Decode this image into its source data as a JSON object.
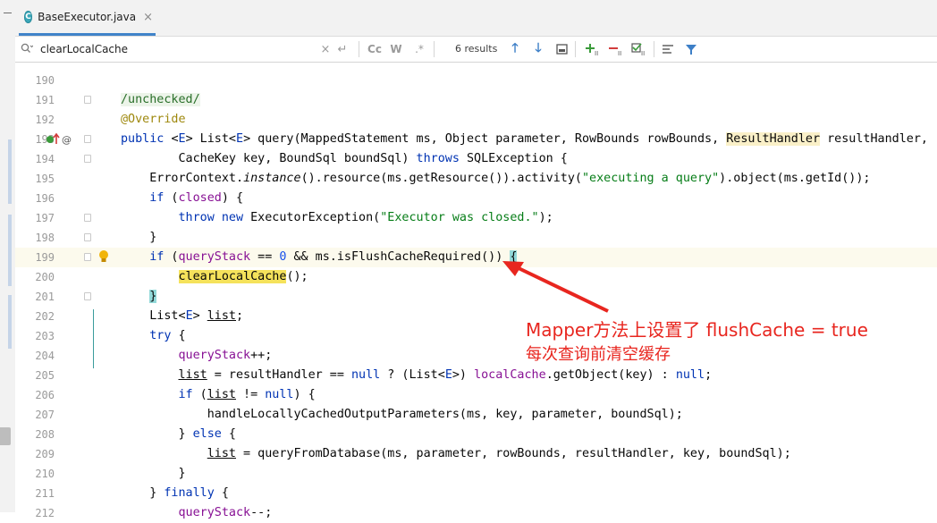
{
  "tab": {
    "filename": "BaseExecutor.java",
    "icon": "java-class-icon",
    "close": "×"
  },
  "search": {
    "value": "clearLocalCache",
    "results": "6 results",
    "buttons": [
      "Cc",
      "W",
      ".*"
    ]
  },
  "lines": [
    {
      "n": "190",
      "segs": []
    },
    {
      "n": "191",
      "segs": [
        [
          "cm",
          "/unchecked/"
        ]
      ]
    },
    {
      "n": "192",
      "segs": [
        [
          "an",
          "@Override"
        ]
      ]
    },
    {
      "n": "193",
      "segs": [
        [
          "kw",
          "public "
        ],
        [
          "",
          "<"
        ],
        [
          "gen",
          "E"
        ],
        [
          "",
          "> List<"
        ],
        [
          "gen",
          "E"
        ],
        [
          "",
          "> query(MappedStatement ms, Object parameter, RowBounds rowBounds, "
        ],
        [
          "rh",
          "ResultHandler"
        ],
        [
          "",
          " resultHandler,"
        ]
      ]
    },
    {
      "n": "194",
      "segs": [
        [
          "",
          "        CacheKey key, BoundSql boundSql) "
        ],
        [
          "kw",
          "throws"
        ],
        [
          "",
          " SQLException {"
        ]
      ]
    },
    {
      "n": "195",
      "segs": [
        [
          "",
          "    ErrorContext."
        ],
        [
          "it",
          "instance"
        ],
        [
          "",
          "().resource(ms.getResource()).activity("
        ],
        [
          "str",
          "\"executing a query\""
        ],
        [
          "",
          ").object(ms.getId());"
        ]
      ]
    },
    {
      "n": "196",
      "segs": [
        [
          "",
          "    "
        ],
        [
          "kw",
          "if"
        ],
        [
          "",
          " ("
        ],
        [
          "fld",
          "closed"
        ],
        [
          "",
          ") {"
        ]
      ]
    },
    {
      "n": "197",
      "segs": [
        [
          "",
          "        "
        ],
        [
          "kw",
          "throw new"
        ],
        [
          "",
          " ExecutorException("
        ],
        [
          "str",
          "\"Executor was closed.\""
        ],
        [
          "",
          ");"
        ]
      ]
    },
    {
      "n": "198",
      "segs": [
        [
          "",
          "    }"
        ]
      ]
    },
    {
      "n": "199",
      "segs": [
        [
          "",
          "    "
        ],
        [
          "kw",
          "if"
        ],
        [
          "",
          " ("
        ],
        [
          "fld",
          "queryStack"
        ],
        [
          "",
          " == "
        ],
        [
          "num",
          "0"
        ],
        [
          "",
          " && ms.isFlushCacheRequired()) "
        ],
        [
          "bracket",
          "{"
        ]
      ]
    },
    {
      "n": "200",
      "segs": [
        [
          "",
          "        "
        ],
        [
          "match",
          "clearLocalCache"
        ],
        [
          "",
          "();"
        ]
      ]
    },
    {
      "n": "201",
      "segs": [
        [
          "",
          "    "
        ],
        [
          "bracket",
          "}"
        ]
      ]
    },
    {
      "n": "202",
      "segs": [
        [
          "",
          "    List<"
        ],
        [
          "gen",
          "E"
        ],
        [
          "",
          "> "
        ],
        [
          "ul",
          "list"
        ],
        [
          "",
          ";"
        ]
      ]
    },
    {
      "n": "203",
      "segs": [
        [
          "",
          "    "
        ],
        [
          "kw",
          "try"
        ],
        [
          "",
          " {"
        ]
      ]
    },
    {
      "n": "204",
      "segs": [
        [
          "",
          "        "
        ],
        [
          "fld",
          "queryStack"
        ],
        [
          "",
          "++;"
        ]
      ]
    },
    {
      "n": "205",
      "segs": [
        [
          "",
          "        "
        ],
        [
          "ul",
          "list"
        ],
        [
          "",
          " = resultHandler == "
        ],
        [
          "kw",
          "null"
        ],
        [
          "",
          " ? (List<"
        ],
        [
          "gen",
          "E"
        ],
        [
          "",
          ">) "
        ],
        [
          "fld",
          "localCache"
        ],
        [
          "",
          ".getObject(key) : "
        ],
        [
          "kw",
          "null"
        ],
        [
          "",
          ";"
        ]
      ]
    },
    {
      "n": "206",
      "segs": [
        [
          "",
          "        "
        ],
        [
          "kw",
          "if"
        ],
        [
          "",
          " ("
        ],
        [
          "ul",
          "list"
        ],
        [
          "",
          " != "
        ],
        [
          "kw",
          "null"
        ],
        [
          "",
          ") {"
        ]
      ]
    },
    {
      "n": "207",
      "segs": [
        [
          "",
          "            handleLocallyCachedOutputParameters(ms, key, parameter, boundSql);"
        ]
      ]
    },
    {
      "n": "208",
      "segs": [
        [
          "",
          "        } "
        ],
        [
          "kw",
          "else"
        ],
        [
          "",
          " {"
        ]
      ]
    },
    {
      "n": "209",
      "segs": [
        [
          "",
          "            "
        ],
        [
          "ul",
          "list"
        ],
        [
          "",
          " = queryFromDatabase(ms, parameter, rowBounds, resultHandler, key, boundSql);"
        ]
      ]
    },
    {
      "n": "210",
      "segs": [
        [
          "",
          "        }"
        ]
      ]
    },
    {
      "n": "211",
      "segs": [
        [
          "",
          "    } "
        ],
        [
          "kw",
          "finally"
        ],
        [
          "",
          " {"
        ]
      ]
    },
    {
      "n": "212",
      "segs": [
        [
          "",
          "        "
        ],
        [
          "fld",
          "queryStack"
        ],
        [
          "",
          "--;"
        ]
      ]
    }
  ],
  "annotation": {
    "line1": "Mapper方法上设置了 flushCache = true",
    "line2": "每次查询前清空缓存",
    "color": "#e8261f"
  },
  "colors": {
    "keyword": "#0033b3",
    "string": "#067d17",
    "field": "#871094",
    "annotation": "#9e880d",
    "accent": "#4083c9"
  }
}
